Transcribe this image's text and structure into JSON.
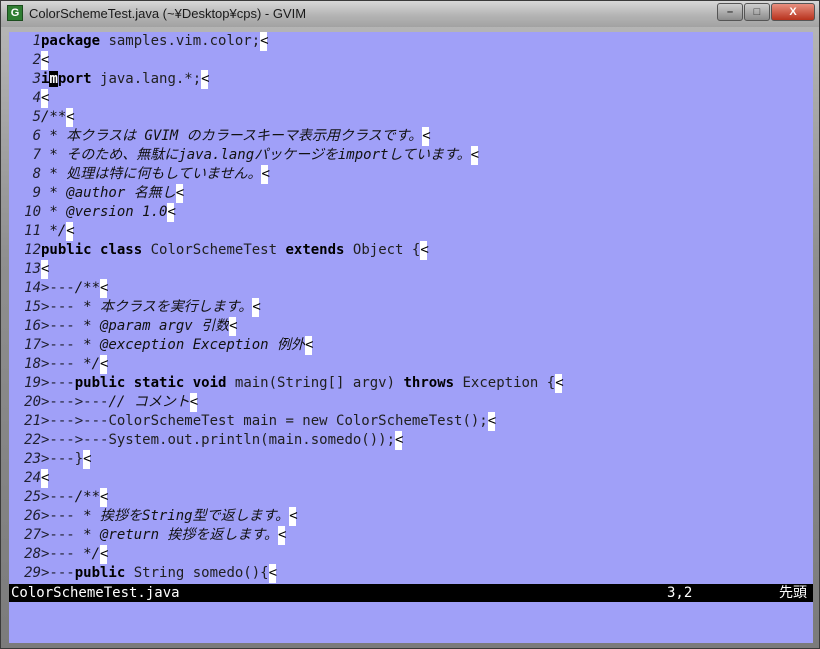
{
  "window": {
    "title": "ColorSchemeTest.java (~¥Desktop¥cps) - GVIM",
    "icon_label": "G",
    "buttons": {
      "minimize": "–",
      "maximize": "□",
      "close": "X"
    }
  },
  "editor": {
    "background": "#a0a0f8",
    "lines": [
      {
        "n": "1",
        "lead": "",
        "segs": [
          {
            "t": "package",
            "c": "kw"
          },
          {
            "t": " samples.vim.color;",
            "c": ""
          }
        ]
      },
      {
        "n": "2",
        "lead": "",
        "segs": []
      },
      {
        "n": "3",
        "lead": "",
        "segs": [
          {
            "t": "i",
            "c": "kw"
          },
          {
            "t": "m",
            "c": "kw cursor"
          },
          {
            "t": "port",
            "c": "kw"
          },
          {
            "t": " java.lang.*;",
            "c": ""
          }
        ]
      },
      {
        "n": "4",
        "lead": "",
        "segs": []
      },
      {
        "n": "5",
        "lead": "",
        "segs": [
          {
            "t": "/**",
            "c": "cm"
          }
        ]
      },
      {
        "n": "6",
        "lead": "",
        "segs": [
          {
            "t": " * 本クラスは GVIM のカラースキーマ表示用クラスです。",
            "c": "cm"
          }
        ]
      },
      {
        "n": "7",
        "lead": "",
        "segs": [
          {
            "t": " * そのため、無駄にjava.langパッケージをimportしています。",
            "c": "cm"
          }
        ]
      },
      {
        "n": "8",
        "lead": "",
        "segs": [
          {
            "t": " * 処理は特に何もしていません。",
            "c": "cm"
          }
        ]
      },
      {
        "n": "9",
        "lead": "",
        "segs": [
          {
            "t": " * @author 名無し",
            "c": "cm"
          }
        ]
      },
      {
        "n": "10",
        "lead": "",
        "segs": [
          {
            "t": " * @version 1.0",
            "c": "cm"
          }
        ]
      },
      {
        "n": "11",
        "lead": "",
        "segs": [
          {
            "t": " */",
            "c": "cm"
          }
        ]
      },
      {
        "n": "12",
        "lead": "",
        "segs": [
          {
            "t": "public",
            "c": "kw"
          },
          {
            "t": " ",
            "c": ""
          },
          {
            "t": "class",
            "c": "kw"
          },
          {
            "t": " ColorSchemeTest ",
            "c": ""
          },
          {
            "t": "extends",
            "c": "kw"
          },
          {
            "t": " Object {",
            "c": ""
          }
        ]
      },
      {
        "n": "13",
        "lead": "",
        "segs": []
      },
      {
        "n": "14",
        "lead": ">---",
        "segs": [
          {
            "t": "/**",
            "c": "cm"
          }
        ]
      },
      {
        "n": "15",
        "lead": ">---",
        "segs": [
          {
            "t": " * 本クラスを実行します。",
            "c": "cm"
          }
        ]
      },
      {
        "n": "16",
        "lead": ">---",
        "segs": [
          {
            "t": " * @param argv 引数",
            "c": "cm"
          }
        ]
      },
      {
        "n": "17",
        "lead": ">---",
        "segs": [
          {
            "t": " * @exception Exception 例外",
            "c": "cm"
          }
        ]
      },
      {
        "n": "18",
        "lead": ">---",
        "segs": [
          {
            "t": " */",
            "c": "cm"
          }
        ]
      },
      {
        "n": "19",
        "lead": ">---",
        "segs": [
          {
            "t": "public",
            "c": "kw"
          },
          {
            "t": " ",
            "c": ""
          },
          {
            "t": "static",
            "c": "kw"
          },
          {
            "t": " ",
            "c": ""
          },
          {
            "t": "void",
            "c": "kw"
          },
          {
            "t": " main(String[] argv) ",
            "c": ""
          },
          {
            "t": "throws",
            "c": "kw"
          },
          {
            "t": " Exception {",
            "c": ""
          }
        ]
      },
      {
        "n": "20",
        "lead": ">--->---",
        "segs": [
          {
            "t": "// コメント",
            "c": "cm"
          }
        ]
      },
      {
        "n": "21",
        "lead": ">--->---",
        "segs": [
          {
            "t": "ColorSchemeTest main = new ColorSchemeTest();",
            "c": ""
          }
        ]
      },
      {
        "n": "22",
        "lead": ">--->---",
        "segs": [
          {
            "t": "System.out.println(main.somedo());",
            "c": ""
          }
        ]
      },
      {
        "n": "23",
        "lead": ">---",
        "segs": [
          {
            "t": "}",
            "c": ""
          }
        ]
      },
      {
        "n": "24",
        "lead": "",
        "segs": []
      },
      {
        "n": "25",
        "lead": ">---",
        "segs": [
          {
            "t": "/**",
            "c": "cm"
          }
        ]
      },
      {
        "n": "26",
        "lead": ">---",
        "segs": [
          {
            "t": " * 挨拶をString型で返します。",
            "c": "cm"
          }
        ]
      },
      {
        "n": "27",
        "lead": ">---",
        "segs": [
          {
            "t": " * @return 挨拶を返します。",
            "c": "cm"
          }
        ]
      },
      {
        "n": "28",
        "lead": ">---",
        "segs": [
          {
            "t": " */",
            "c": "cm"
          }
        ]
      },
      {
        "n": "29",
        "lead": ">---",
        "segs": [
          {
            "t": "public",
            "c": "kw"
          },
          {
            "t": " String somedo(){",
            "c": ""
          }
        ]
      }
    ],
    "eol_marker": "<"
  },
  "statusline": {
    "filename": "ColorSchemeTest.java",
    "position": "3,2",
    "scroll": "先頭"
  }
}
